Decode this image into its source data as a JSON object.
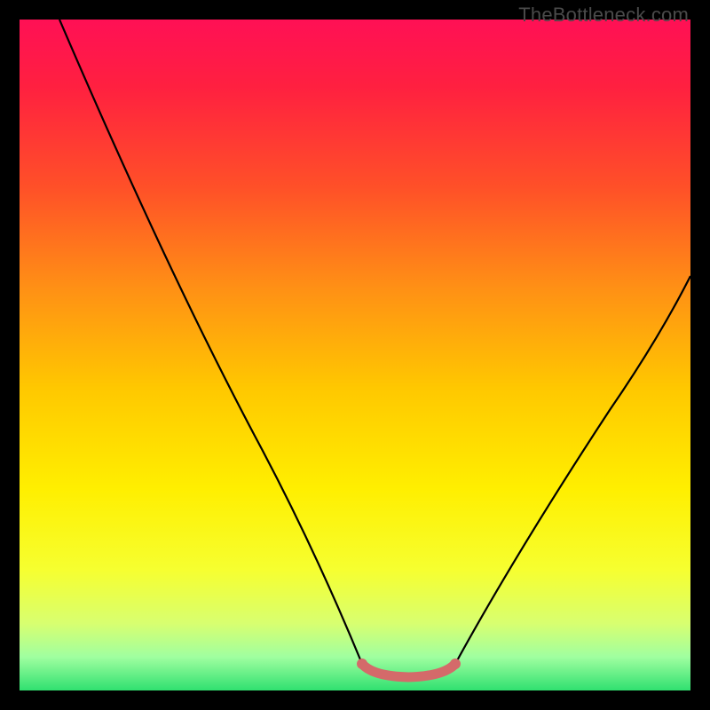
{
  "watermark": "TheBottleneck.com",
  "chart_data": {
    "type": "line",
    "title": "",
    "xlabel": "",
    "ylabel": "",
    "xlim": [
      0,
      100
    ],
    "ylim": [
      0,
      100
    ],
    "gradient_stops": [
      {
        "pos": 0.0,
        "color": "#ff1055"
      },
      {
        "pos": 0.1,
        "color": "#ff2040"
      },
      {
        "pos": 0.25,
        "color": "#ff5028"
      },
      {
        "pos": 0.4,
        "color": "#ff9015"
      },
      {
        "pos": 0.55,
        "color": "#ffc800"
      },
      {
        "pos": 0.7,
        "color": "#ffef00"
      },
      {
        "pos": 0.82,
        "color": "#f6ff30"
      },
      {
        "pos": 0.9,
        "color": "#d8ff70"
      },
      {
        "pos": 0.95,
        "color": "#a0ffa0"
      },
      {
        "pos": 1.0,
        "color": "#30e070"
      }
    ],
    "series": [
      {
        "name": "left-curve",
        "points": [
          {
            "x": 6,
            "y": 100
          },
          {
            "x": 20,
            "y": 70
          },
          {
            "x": 35,
            "y": 38
          },
          {
            "x": 45,
            "y": 15
          },
          {
            "x": 51,
            "y": 4
          }
        ]
      },
      {
        "name": "flat-segment",
        "stroke": "#d46a6a",
        "stroke_width": 8,
        "points": [
          {
            "x": 51,
            "y": 4
          },
          {
            "x": 53,
            "y": 2.3
          },
          {
            "x": 58,
            "y": 2
          },
          {
            "x": 63,
            "y": 2.3
          },
          {
            "x": 65,
            "y": 4
          }
        ]
      },
      {
        "name": "right-curve",
        "points": [
          {
            "x": 65,
            "y": 4
          },
          {
            "x": 75,
            "y": 20
          },
          {
            "x": 88,
            "y": 42
          },
          {
            "x": 100,
            "y": 62
          }
        ]
      }
    ]
  }
}
